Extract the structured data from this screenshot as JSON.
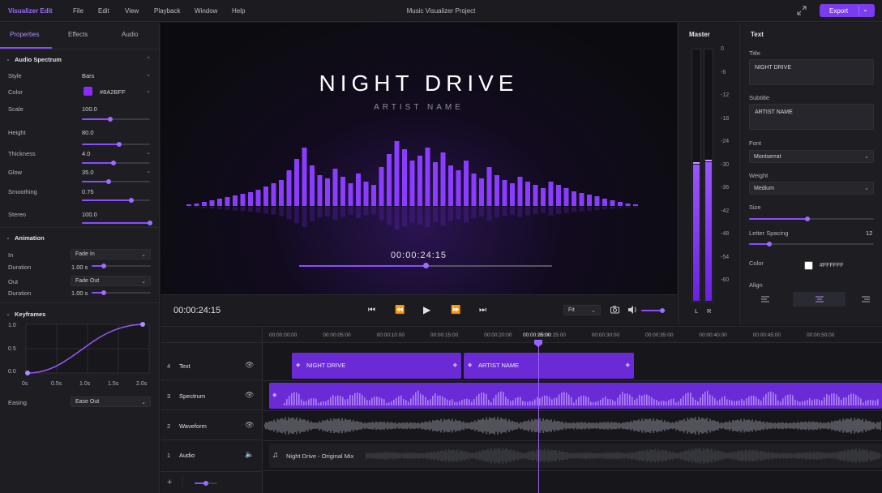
{
  "app": {
    "brand": "Visualizer Edit",
    "project": "Music Visualizer Project",
    "export_label": "Export",
    "menu": [
      "File",
      "Edit",
      "View",
      "Playback",
      "Window",
      "Help"
    ]
  },
  "left": {
    "tabs": [
      "Properties",
      "Effects",
      "Audio"
    ],
    "spectrum": {
      "title": "Audio Spectrum",
      "style": {
        "label": "Style",
        "value": "Bars"
      },
      "color": {
        "label": "Color",
        "value": "#8A2BFF",
        "swatch": "#8a2bff"
      },
      "scale": {
        "label": "Scale",
        "value": "100.0",
        "level": 0.42
      },
      "height": {
        "label": "Height",
        "value": "80.0",
        "level": 0.55
      },
      "thickness": {
        "label": "Thickness",
        "value": "4.0",
        "level": 0.47
      },
      "glow": {
        "label": "Glow",
        "value": "35.0",
        "level": 0.39
      },
      "smoothing": {
        "label": "Smoothing",
        "value": "0.75",
        "level": 0.73
      },
      "stereo": {
        "label": "Stereo",
        "value": "100.0",
        "level": 1.0
      }
    },
    "animation": {
      "title": "Animation",
      "in": {
        "label": "In",
        "value": "Fade In"
      },
      "in_duration": {
        "label": "Duration",
        "value": "1.00 s",
        "level": 0.2
      },
      "out": {
        "label": "Out",
        "value": "Fade Out"
      },
      "out_duration": {
        "label": "Duration",
        "value": "1.00 s",
        "level": 0.2
      }
    },
    "keyframes": {
      "title": "Keyframes",
      "y_ticks": [
        "1.0",
        "0.5",
        "0.0"
      ],
      "x_ticks": [
        "0s",
        "0.5s",
        "1.0s",
        "1.5s",
        "2.0s"
      ],
      "easing": {
        "label": "Easing",
        "value": "Ease Out"
      }
    }
  },
  "preview": {
    "title": "NIGHT DRIVE",
    "subtitle": "ARTIST NAME",
    "time": "00:00:24:15",
    "progress": 0.5,
    "bars": [
      2,
      3,
      5,
      7,
      9,
      11,
      13,
      15,
      17,
      20,
      24,
      28,
      32,
      44,
      58,
      72,
      50,
      38,
      34,
      46,
      36,
      28,
      40,
      30,
      26,
      48,
      64,
      80,
      70,
      56,
      62,
      72,
      54,
      66,
      50,
      44,
      56,
      40,
      34,
      48,
      38,
      32,
      28,
      36,
      30,
      26,
      22,
      30,
      26,
      22,
      18,
      16,
      14,
      12,
      9,
      7,
      5,
      3,
      2
    ]
  },
  "transport": {
    "time": "00:00:24:15",
    "fit": "Fit",
    "volume": 0.85
  },
  "master": {
    "title": "Master",
    "scale": [
      "0",
      "-6",
      "-12",
      "-18",
      "-24",
      "-30",
      "-36",
      "-42",
      "-48",
      "-54",
      "-60"
    ],
    "l_label": "L",
    "r_label": "R",
    "left_level": 0.54,
    "right_level": 0.55
  },
  "text_panel": {
    "title": "Text",
    "title_field": {
      "label": "Title",
      "value": "NIGHT DRIVE"
    },
    "subtitle_field": {
      "label": "Subtitle",
      "value": "ARTIST NAME"
    },
    "font": {
      "label": "Font",
      "value": "Montserrat"
    },
    "weight": {
      "label": "Weight",
      "value": "Medium"
    },
    "size": {
      "label": "Size",
      "level": 0.47
    },
    "letter_spacing": {
      "label": "Letter Spacing",
      "value": "12",
      "level": 0.16
    },
    "color": {
      "label": "Color",
      "value": "#FFFFFF",
      "swatch": "#ffffff"
    },
    "align": {
      "label": "Align",
      "active": "center"
    }
  },
  "timeline": {
    "playhead": "00:00:25:00",
    "ruler": [
      "00:00:00:00",
      "00:00:05:00",
      "00:00:10:00",
      "00:00:15:00",
      "00:00:20:00",
      "00:00:25:00",
      "00:00:30:00",
      "00:00:35:00",
      "00:00:40:00",
      "00:00:45:00",
      "00:00:50:00"
    ],
    "tracks": [
      {
        "num": "4",
        "name": "Text"
      },
      {
        "num": "3",
        "name": "Spectrum"
      },
      {
        "num": "2",
        "name": "Waveform"
      },
      {
        "num": "1",
        "name": "Audio"
      }
    ],
    "clips": {
      "title": "NIGHT DRIVE",
      "subtitle": "ARTIST NAME",
      "audio": "Night Drive - Original Mix"
    },
    "zoom": 0.5
  }
}
